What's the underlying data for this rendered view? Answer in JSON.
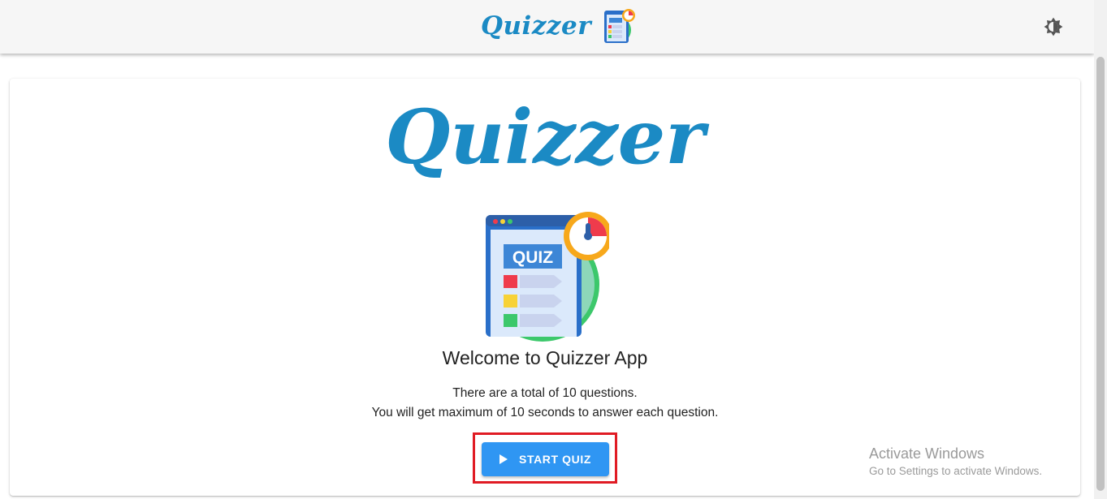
{
  "header": {
    "brand": "Quizzer",
    "theme_toggle_icon": "brightness-icon"
  },
  "card": {
    "logo": "Quizzer",
    "illustration_label": "QUIZ",
    "welcome": "Welcome to Quizzer App",
    "desc_line1": "There are a total of 10 questions.",
    "desc_line2": "You will get maximum of 10 seconds to answer each question.",
    "start_button": "START QUIZ"
  },
  "watermark": {
    "title": "Activate Windows",
    "subtitle": "Go to Settings to activate Windows."
  },
  "colors": {
    "brand": "#1b8ac4",
    "button": "#2f96f3",
    "highlight": "#e01b24"
  }
}
